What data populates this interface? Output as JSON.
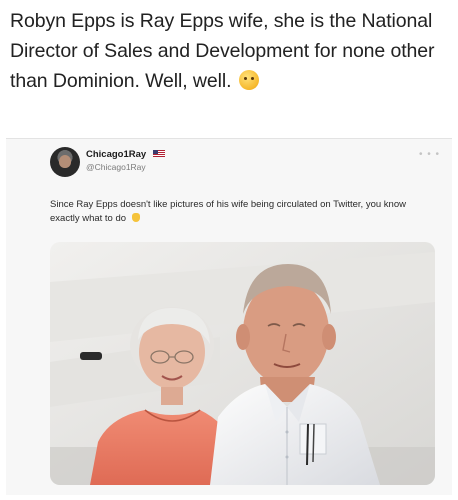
{
  "caption": {
    "text": "Robyn Epps is Ray Epps wife, she is the National Director of Sales and Development for none other than Dominion. Well, well."
  },
  "tweet": {
    "display_name": "Chicago1Ray",
    "handle": "@Chicago1Ray",
    "text": "Since Ray Epps doesn't like pictures of his wife being circulated on Twitter, you know exactly what to do",
    "photo": {
      "alt": "photo-of-older-couple"
    }
  },
  "icons": {
    "caption_emoji": "thinking-face-icon",
    "name_flag": "us-flag-icon",
    "more": "more-options-icon",
    "text_emoji": "pointing-hand-icon"
  },
  "colors": {
    "background": "#ffffff",
    "card_background": "#f7f7f7",
    "caption_text": "#222222",
    "handle_text": "#7b7b7b"
  }
}
